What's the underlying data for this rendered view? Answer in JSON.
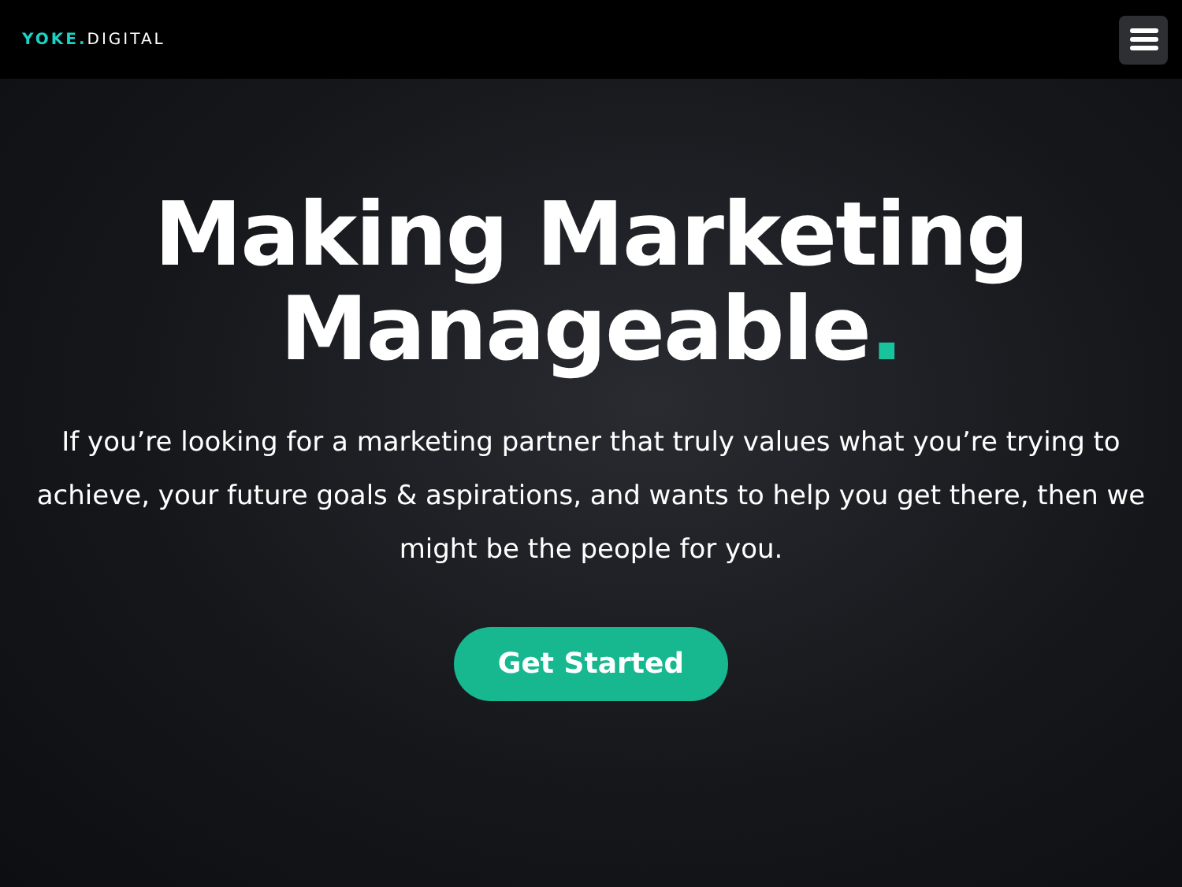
{
  "header": {
    "logo_brand": "YOKE.",
    "logo_suffix": "DIGITAL"
  },
  "hero": {
    "headline": "Making Marketing Manageable",
    "headline_accent": ".",
    "body": "If you’re looking for a marketing partner that truly values what you’re trying to achieve, your future goals & aspirations, and wants to help you get there, then we might be the people for you.",
    "cta": "Get Started"
  }
}
